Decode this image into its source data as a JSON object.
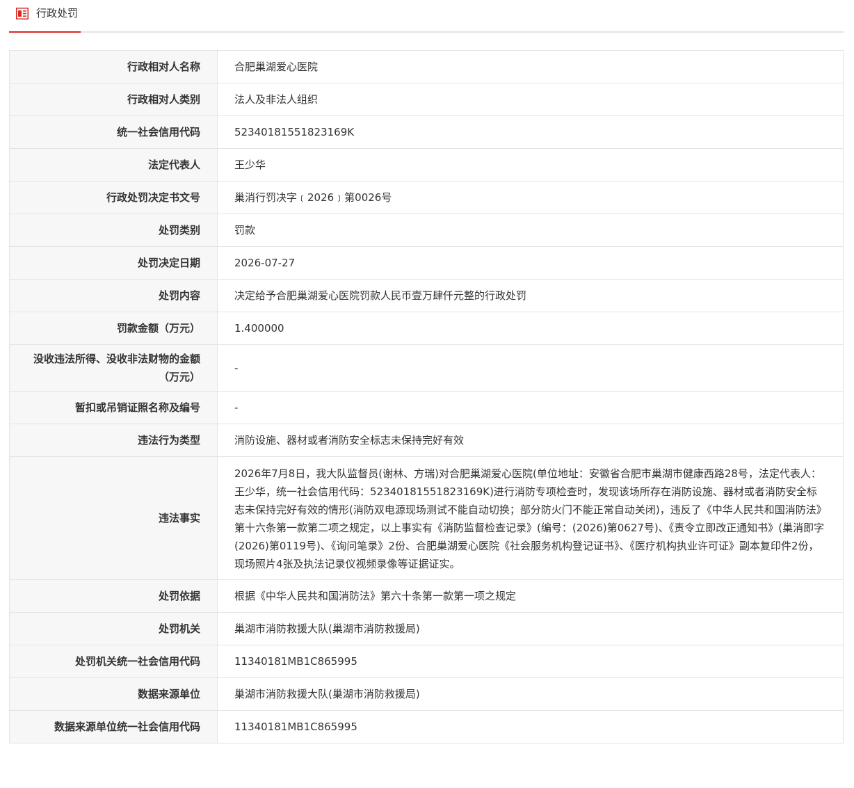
{
  "tab": {
    "label": "行政处罚",
    "icon": "document-list-icon",
    "accent_color": "#d9281f"
  },
  "rows": [
    {
      "label": "行政相对人名称",
      "value": "合肥巢湖爱心医院"
    },
    {
      "label": "行政相对人类别",
      "value": "法人及非法人组织"
    },
    {
      "label": "统一社会信用代码",
      "value": "52340181551823169K"
    },
    {
      "label": "法定代表人",
      "value": "王少华"
    },
    {
      "label": "行政处罚决定书文号",
      "value": "巢消行罚决字﹝2026﹞第0026号"
    },
    {
      "label": "处罚类别",
      "value": "罚款"
    },
    {
      "label": "处罚决定日期",
      "value": "2026-07-27"
    },
    {
      "label": "处罚内容",
      "value": "决定给予合肥巢湖爱心医院罚款人民币壹万肆仟元整的行政处罚"
    },
    {
      "label": "罚款金额（万元）",
      "value": "1.400000"
    },
    {
      "label": "没收违法所得、没收非法财物的金额（万元）",
      "value": "-"
    },
    {
      "label": "暂扣或吊销证照名称及编号",
      "value": "-"
    },
    {
      "label": "违法行为类型",
      "value": "消防设施、器材或者消防安全标志未保持完好有效"
    },
    {
      "label": "违法事实",
      "value": "2026年7月8日，我大队监督员(谢林、方瑞)对合肥巢湖爱心医院(单位地址：安徽省合肥市巢湖市健康西路28号，法定代表人：王少华，统一社会信用代码：52340181551823169K)进行消防专项检查时，发现该场所存在消防设施、器材或者消防安全标志未保持完好有效的情形(消防双电源现场测试不能自动切换；部分防火门不能正常自动关闭)，违反了《中华人民共和国消防法》第十六条第一款第二项之规定，以上事实有《消防监督检查记录》(编号：(2026)第0627号)、《责令立即改正通知书》(巢消即字(2026)第0119号)、《询问笔录》2份、合肥巢湖爱心医院《社会服务机构登记证书》、《医疗机构执业许可证》副本复印件2份，现场照片4张及执法记录仪视频录像等证据证实。"
    },
    {
      "label": "处罚依据",
      "value": "根据《中华人民共和国消防法》第六十条第一款第一项之规定"
    },
    {
      "label": "处罚机关",
      "value": "巢湖市消防救援大队(巢湖市消防救援局)"
    },
    {
      "label": "处罚机关统一社会信用代码",
      "value": "11340181MB1C865995"
    },
    {
      "label": "数据来源单位",
      "value": "巢湖市消防救援大队(巢湖市消防救援局)"
    },
    {
      "label": "数据来源单位统一社会信用代码",
      "value": "11340181MB1C865995"
    }
  ]
}
